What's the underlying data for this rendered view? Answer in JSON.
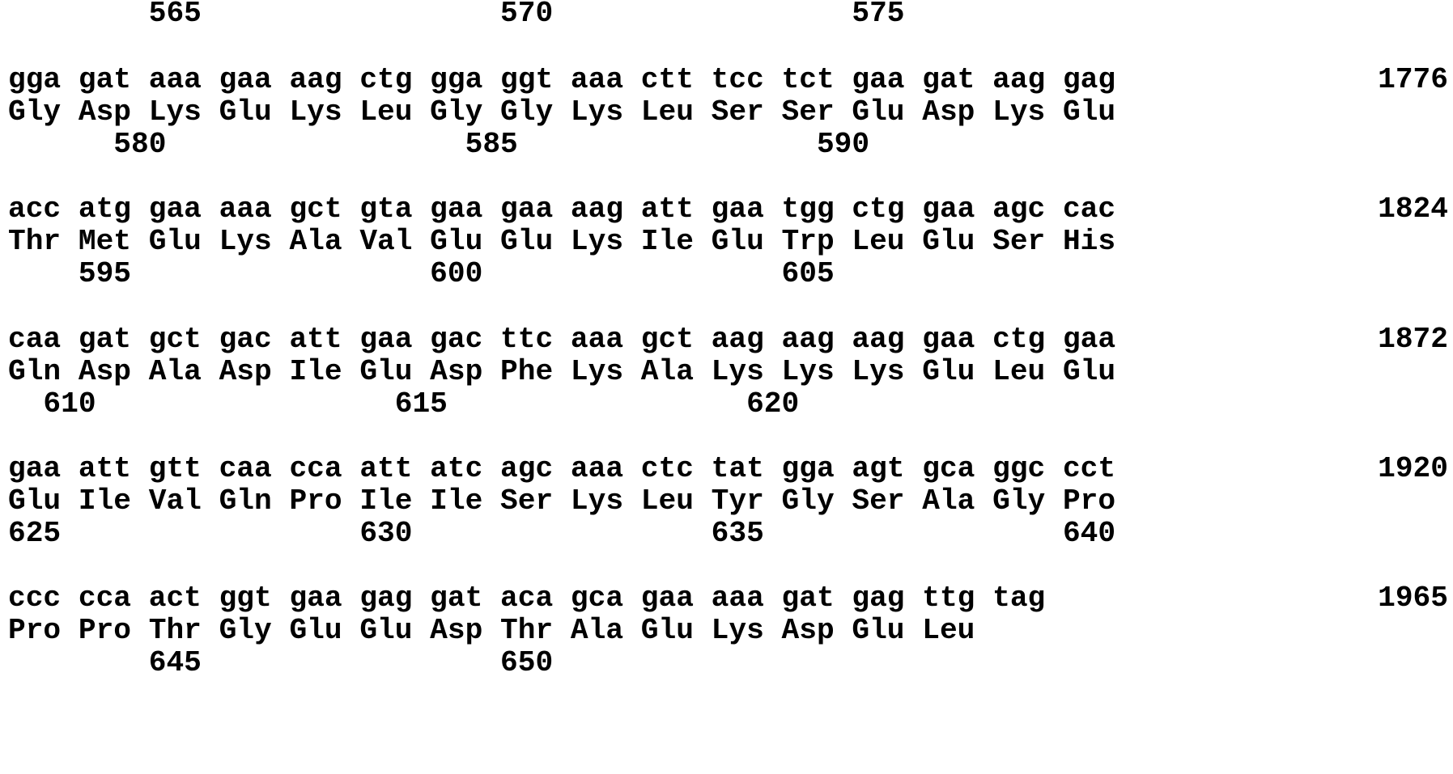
{
  "sequence_listing": {
    "header_numbers": "        565                 570                 575",
    "blocks": [
      {
        "codons": "gga gat aaa gaa aag ctg gga ggt aaa ctt tcc tct gaa gat aag gag",
        "amino_acids": "Gly Asp Lys Glu Lys Leu Gly Gly Lys Leu Ser Ser Glu Asp Lys Glu",
        "residue_numbers": "      580                 585                 590",
        "nucleotide_position": "1776"
      },
      {
        "codons": "acc atg gaa aaa gct gta gaa gaa aag att gaa tgg ctg gaa agc cac",
        "amino_acids": "Thr Met Glu Lys Ala Val Glu Glu Lys Ile Glu Trp Leu Glu Ser His",
        "residue_numbers": "    595                 600                 605",
        "nucleotide_position": "1824"
      },
      {
        "codons": "caa gat gct gac att gaa gac ttc aaa gct aag aag aag gaa ctg gaa",
        "amino_acids": "Gln Asp Ala Asp Ile Glu Asp Phe Lys Ala Lys Lys Lys Glu Leu Glu",
        "residue_numbers": "  610                 615                 620",
        "nucleotide_position": "1872"
      },
      {
        "codons": "gaa att gtt caa cca att atc agc aaa ctc tat gga agt gca ggc cct",
        "amino_acids": "Glu Ile Val Gln Pro Ile Ile Ser Lys Leu Tyr Gly Ser Ala Gly Pro",
        "residue_numbers": "625                 630                 635                 640",
        "nucleotide_position": "1920"
      },
      {
        "codons": "ccc cca act ggt gaa gag gat aca gca gaa aaa gat gag ttg tag",
        "amino_acids": "Pro Pro Thr Gly Glu Glu Asp Thr Ala Glu Lys Asp Glu Leu",
        "residue_numbers": "        645                 650",
        "nucleotide_position": "1965"
      }
    ]
  }
}
